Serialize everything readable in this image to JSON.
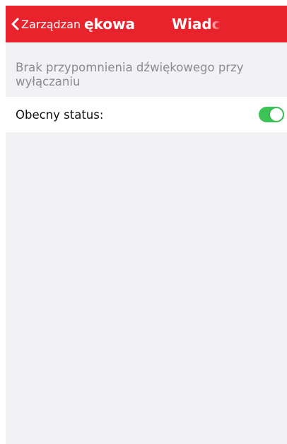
{
  "colors": {
    "navbar_background": "#e8232c",
    "navbar_text": "#ffffff",
    "page_background": "#f2f2f4",
    "description_text": "#8a8a8f",
    "toggle_on": "#3cc356"
  },
  "navbar": {
    "back_icon": "chevron-left-icon",
    "back_label": "Zarządzan",
    "overlap_title": "ękowa",
    "title": "Wiadc"
  },
  "notice": {
    "description": "Brak przypomnienia dźwiękowego przy wyłączaniu"
  },
  "status": {
    "label": "Obecny status:",
    "toggle_on": true
  }
}
